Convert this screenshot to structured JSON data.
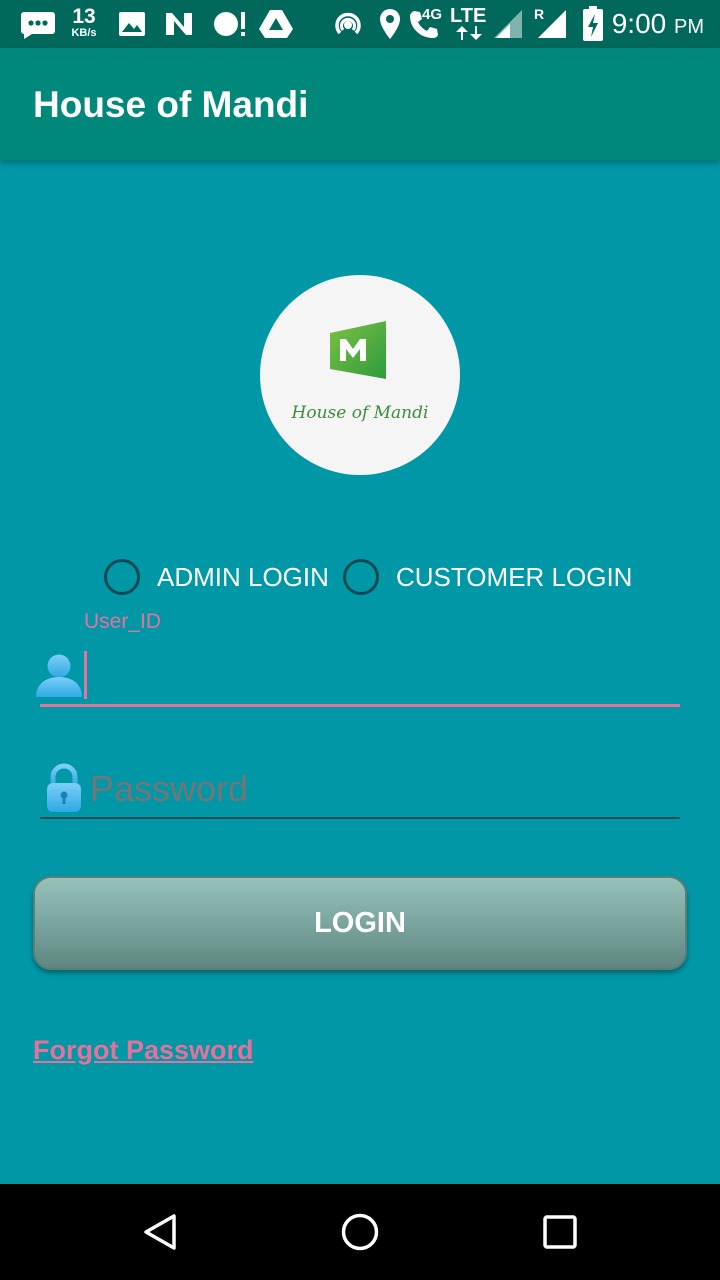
{
  "status_bar": {
    "net_speed_value": "13",
    "net_speed_unit": "KB/s",
    "network_type": "4G",
    "lte_label": "LTE",
    "roaming_label": "R",
    "time": "9:00",
    "ampm": "PM",
    "icons": [
      "messaging-icon",
      "image-icon",
      "n-icon",
      "notification-icon",
      "drive-icon",
      "hotspot-icon",
      "location-icon",
      "volte-call-icon",
      "signal-icon",
      "signal-roaming-icon",
      "battery-charging-icon"
    ]
  },
  "app_bar": {
    "title": "House of Mandi"
  },
  "logo": {
    "caption": "House of Mandi",
    "brand_color": "#4CAF50"
  },
  "login_type": {
    "options": [
      {
        "label": "ADMIN LOGIN",
        "selected": false
      },
      {
        "label": "CUSTOMER LOGIN",
        "selected": false
      }
    ]
  },
  "form": {
    "user_id_label": "User_ID",
    "user_id_value": "",
    "password_placeholder": "Password",
    "login_button": "LOGIN",
    "forgot_password": "Forgot Password"
  },
  "nav_bar": {
    "buttons": [
      "back-icon",
      "home-icon",
      "recents-icon"
    ]
  },
  "colors": {
    "status_bar": "#00695C",
    "app_bar": "#00897B",
    "background": "#0097A7",
    "accent": "#E4729B"
  }
}
